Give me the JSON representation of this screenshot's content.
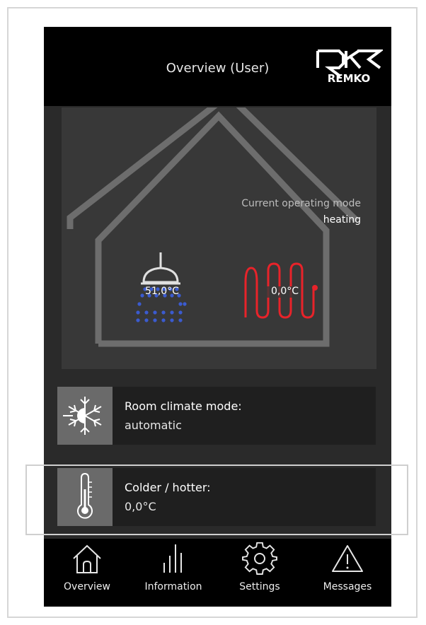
{
  "header": {
    "title": "Overview (User)",
    "logo_text": "REMKO"
  },
  "status": {
    "operating_mode_label": "Current operating mode",
    "operating_mode_value": "heating",
    "hot_water_temp": "51,0°C",
    "heating_temp": "0,0°C"
  },
  "cards": {
    "room_climate": {
      "label": "Room climate mode:",
      "value": "automatic",
      "icon": "snowflake-sun-icon"
    },
    "colder_hotter": {
      "label": "Colder / hotter:",
      "value": "0,0°C",
      "icon": "thermometer-icon"
    }
  },
  "tabs": [
    {
      "label": "Overview",
      "icon": "home-icon",
      "active": true
    },
    {
      "label": "Information",
      "icon": "bars-icon",
      "active": false
    },
    {
      "label": "Settings",
      "icon": "gear-icon",
      "active": false
    },
    {
      "label": "Messages",
      "icon": "warning-icon",
      "active": false
    }
  ],
  "colors": {
    "shower_drops": "#3b5bcf",
    "heater_coil": "#e8232a",
    "background": "#2a2a2a"
  }
}
